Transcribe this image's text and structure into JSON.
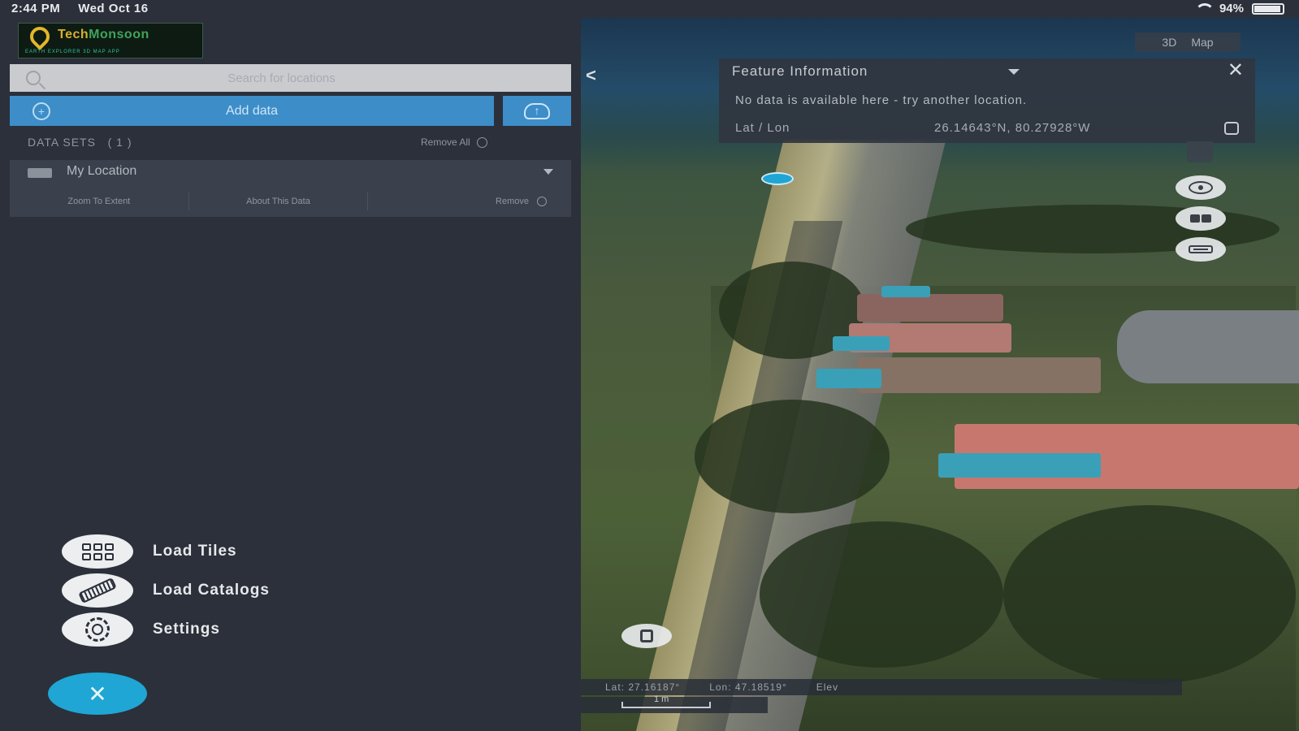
{
  "status_bar": {
    "time": "2:44 PM",
    "date": "Wed Oct 16",
    "battery": "94%"
  },
  "logo": {
    "brand_a": "Tech",
    "brand_b": "Monsoon",
    "tagline": "EARTH EXPLORER 3D MAP APP"
  },
  "search": {
    "placeholder": "Search for locations"
  },
  "add_data": {
    "label": "Add data"
  },
  "datasets": {
    "header": "DATA SETS",
    "count": "( 1 )",
    "remove_all": "Remove All",
    "items": [
      {
        "name": "My Location",
        "zoom": "Zoom To Extent",
        "about": "About This Data",
        "remove": "Remove"
      }
    ]
  },
  "menu": {
    "load_tiles": "Load Tiles",
    "load_catalogs": "Load Catalogs",
    "settings": "Settings"
  },
  "map": {
    "toggle_3d": "3D",
    "toggle_map": "Map",
    "back": "<",
    "feature": {
      "title": "Feature Information",
      "message": "No data is available here - try another location.",
      "latlon_label": "Lat / Lon",
      "latlon_value": "26.14643°N, 80.27928°W"
    },
    "bottom": {
      "lat": "Lat: 27.16187°",
      "lon": "Lon: 47.18519°",
      "elev": "Elev"
    },
    "scale_label": "1 m"
  },
  "colors": {
    "panel_bg": "#2b303a",
    "accent_blue": "#3d8dc8",
    "fab_blue": "#1fa6d4"
  }
}
